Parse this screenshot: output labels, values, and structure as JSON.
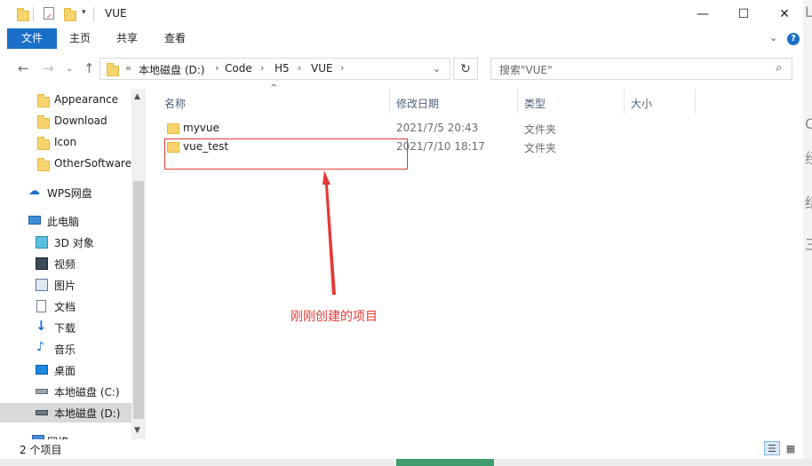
{
  "window": {
    "title": "VUE"
  },
  "ribbon": {
    "tabs": [
      "文件",
      "主页",
      "共享",
      "查看"
    ]
  },
  "address": {
    "overflow": "«",
    "path": [
      "本地磁盘 (D:)",
      "Code",
      "H5",
      "VUE"
    ]
  },
  "search": {
    "placeholder": "搜索\"VUE\""
  },
  "sidebar": {
    "quick": [
      "Appearance",
      "Download",
      "Icon",
      "OtherSoftware"
    ],
    "wps": "WPS网盘",
    "pc": "此电脑",
    "pc_items": [
      "3D 对象",
      "视频",
      "图片",
      "文档",
      "下载",
      "音乐",
      "桌面",
      "本地磁盘 (C:)",
      "本地磁盘 (D:)"
    ],
    "network": "网络"
  },
  "columns": {
    "name": "名称",
    "date": "修改日期",
    "type": "类型",
    "size": "大小"
  },
  "files": [
    {
      "name": "myvue",
      "date": "2021/7/5 20:43",
      "type": "文件夹"
    },
    {
      "name": "vue_test",
      "date": "2021/7/10 18:17",
      "type": "文件夹"
    }
  ],
  "annotation": {
    "text": "刚刚创建的项目"
  },
  "status": {
    "count": "2 个项目"
  },
  "colors": {
    "accent": "#1a6fc9",
    "folder": "#f7d36d",
    "annotation": "#e53935"
  }
}
